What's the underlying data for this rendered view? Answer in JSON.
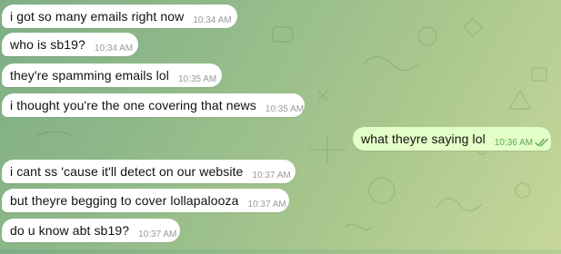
{
  "colors": {
    "incoming_bubble": "#ffffff",
    "outgoing_bubble": "#e3fec6",
    "outgoing_time": "#5fa95b",
    "incoming_time": "#9a9a9a"
  },
  "messages": [
    {
      "text": "i got so many emails right now",
      "time": "10:34 AM",
      "direction": "incoming"
    },
    {
      "text": "who is sb19?",
      "time": "10:34 AM",
      "direction": "incoming"
    },
    {
      "text": "they're spamming emails lol",
      "time": "10:35 AM",
      "direction": "incoming"
    },
    {
      "text": "i thought you're the one covering that news",
      "time": "10:35 AM",
      "direction": "incoming"
    },
    {
      "text": "what theyre saying lol",
      "time": "10:36 AM",
      "direction": "outgoing",
      "status_icon": "double-check-icon"
    },
    {
      "text": "i cant ss 'cause it'll detect on our website",
      "time": "10:37 AM",
      "direction": "incoming"
    },
    {
      "text": "but theyre begging to cover lollapalooza",
      "time": "10:37 AM",
      "direction": "incoming"
    },
    {
      "text": "do u know abt sb19?",
      "time": "10:37 AM",
      "direction": "incoming"
    }
  ]
}
